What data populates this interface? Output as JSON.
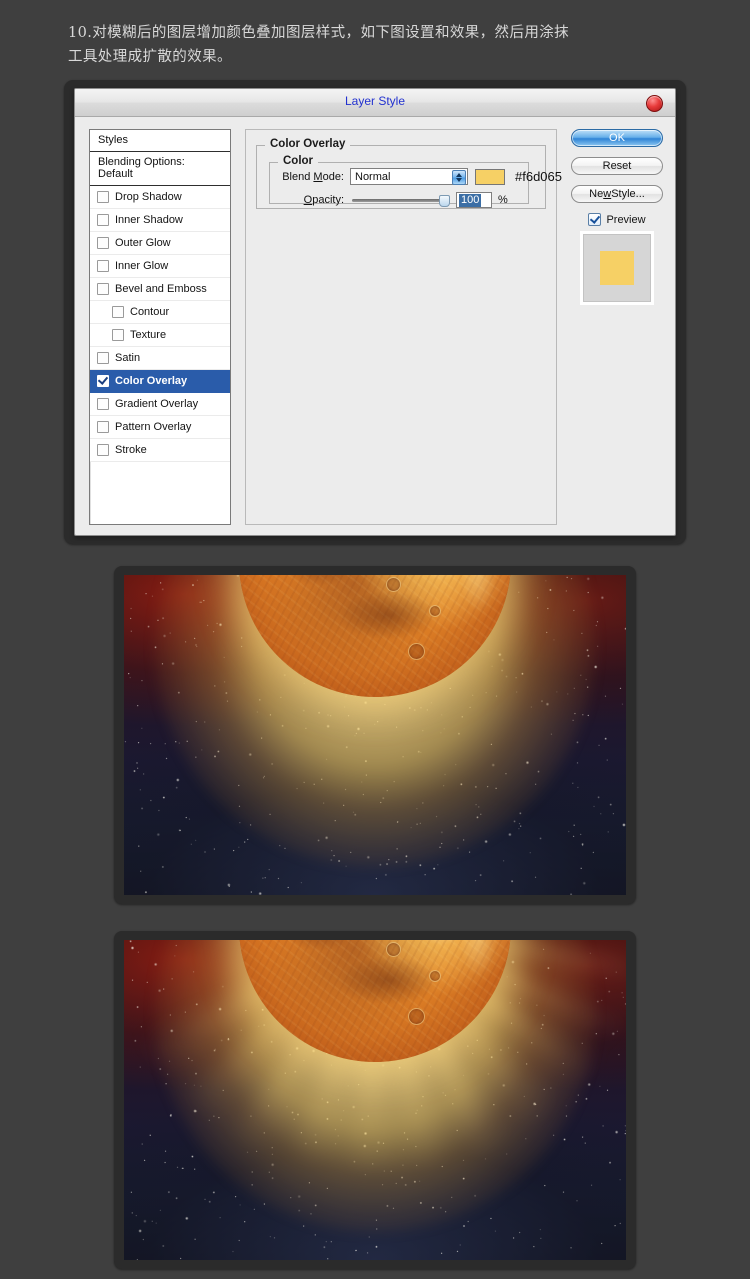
{
  "instruction": {
    "text": "10.对模糊后的图层增加颜色叠加图层样式，如下图设置和效果，然后用涂抹\n工具处理成扩散的效果。"
  },
  "dialog": {
    "title": "Layer Style",
    "close_icon": "close-red-circle-icon",
    "styles_list": {
      "header": "Styles",
      "blending_options": "Blending Options: Default",
      "items": [
        {
          "label": "Drop Shadow",
          "checked": false,
          "indent": false,
          "selected": false
        },
        {
          "label": "Inner Shadow",
          "checked": false,
          "indent": false,
          "selected": false
        },
        {
          "label": "Outer Glow",
          "checked": false,
          "indent": false,
          "selected": false
        },
        {
          "label": "Inner Glow",
          "checked": false,
          "indent": false,
          "selected": false
        },
        {
          "label": "Bevel and Emboss",
          "checked": false,
          "indent": false,
          "selected": false
        },
        {
          "label": "Contour",
          "checked": false,
          "indent": true,
          "selected": false
        },
        {
          "label": "Texture",
          "checked": false,
          "indent": true,
          "selected": false
        },
        {
          "label": "Satin",
          "checked": false,
          "indent": false,
          "selected": false
        },
        {
          "label": "Color Overlay",
          "checked": true,
          "indent": false,
          "selected": true
        },
        {
          "label": "Gradient Overlay",
          "checked": false,
          "indent": false,
          "selected": false
        },
        {
          "label": "Pattern Overlay",
          "checked": false,
          "indent": false,
          "selected": false
        },
        {
          "label": "Stroke",
          "checked": false,
          "indent": false,
          "selected": false
        }
      ]
    },
    "color_overlay": {
      "group_title": "Color Overlay",
      "color_group_title": "Color",
      "blend_mode_label": "Blend Mode:",
      "blend_mode_value": "Normal",
      "blend_mode_options": [
        "Normal"
      ],
      "color_hex": "#f6d065",
      "color_swatch": "#f6d065",
      "opacity_label": "Opacity:",
      "opacity_value": "100",
      "opacity_unit": "%"
    },
    "buttons": {
      "ok": "OK",
      "reset": "Reset",
      "new_style": "New Style...",
      "preview_label": "Preview",
      "preview_checked": true
    },
    "preview": {
      "chip_color": "#f6d065",
      "backdrop_color": "#d6d6d6"
    }
  },
  "images": [
    {
      "caption": "",
      "alt": "glowing orange planet over starfield nebula"
    },
    {
      "caption": "",
      "alt": "glowing orange planet with smudged radiating light rays"
    }
  ],
  "colors": {
    "page_background": "#3f3f3f",
    "accent_blue": "#2a5caa",
    "title_blue": "#2231cf",
    "overlay_gold": "#f6d065"
  }
}
